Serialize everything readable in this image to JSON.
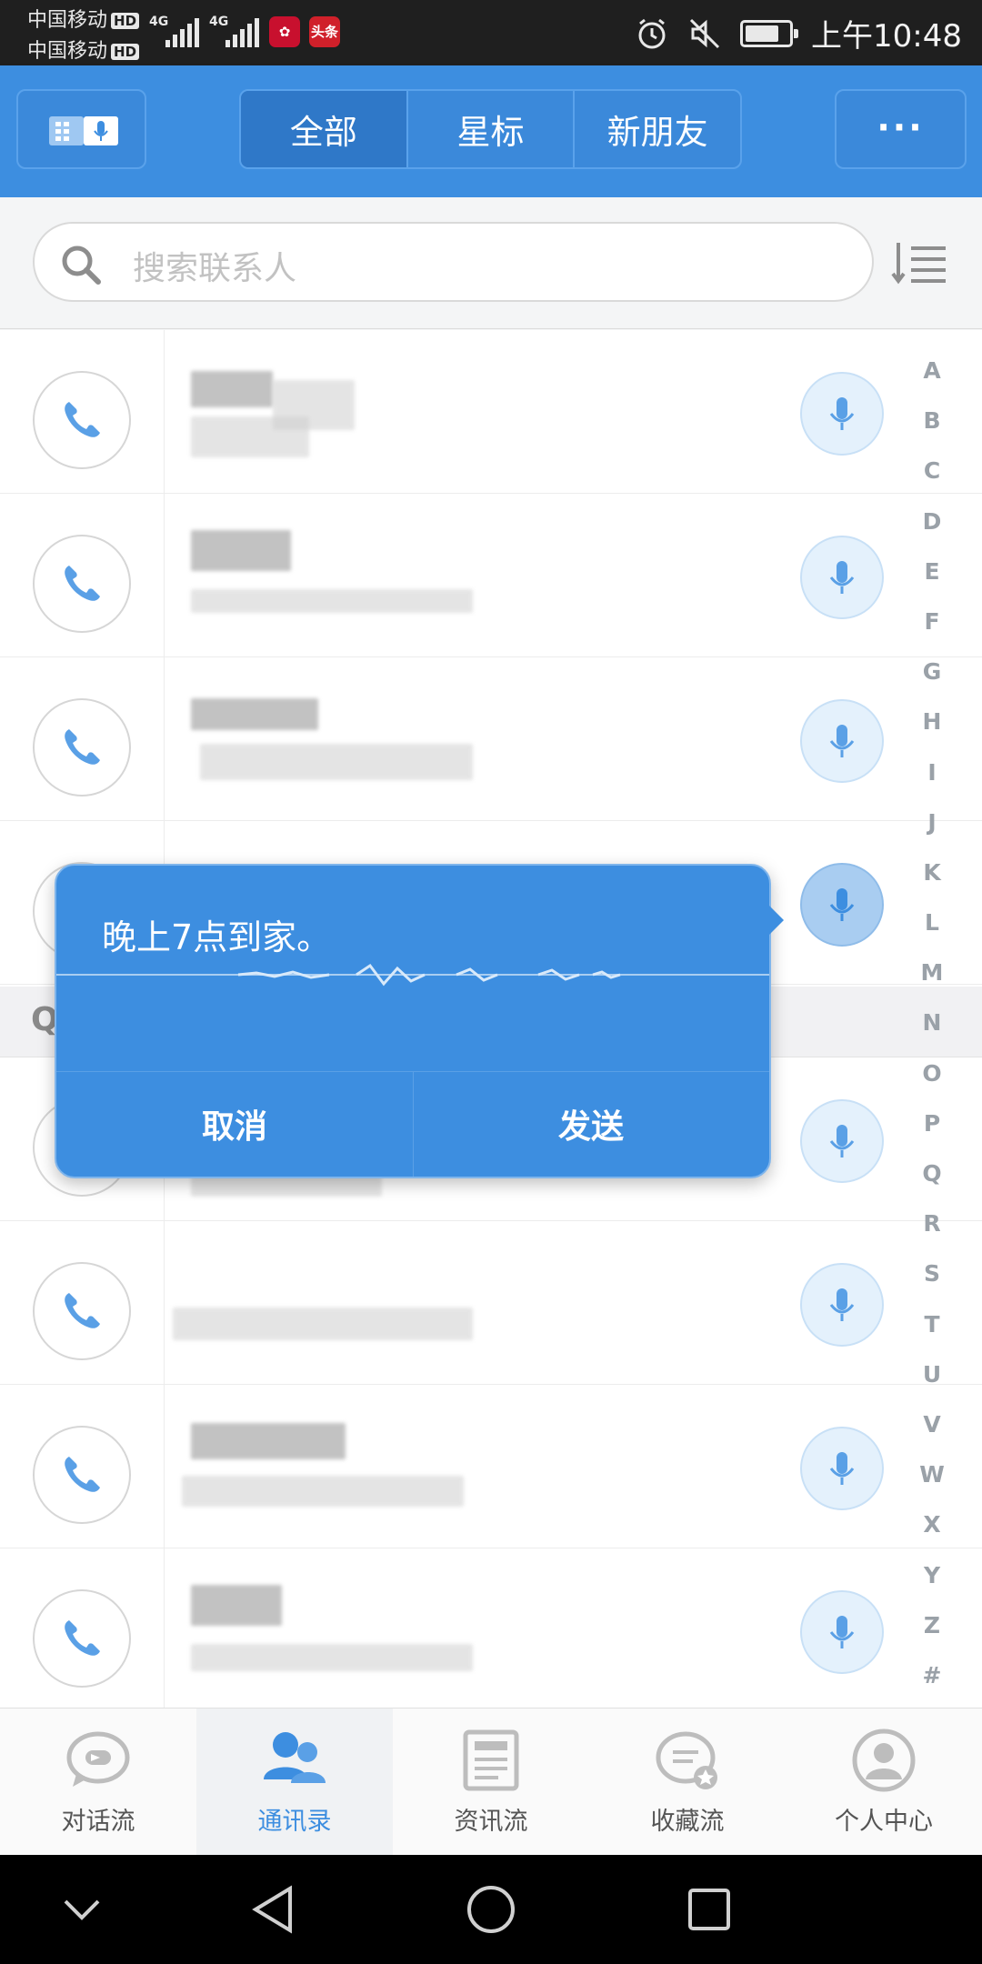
{
  "status_bar": {
    "carrier1": "中国移动",
    "carrier2": "中国移动",
    "hd": "HD",
    "net1": "4G",
    "net2": "4G",
    "app_badge": "头条",
    "time": "上午10:48"
  },
  "header": {
    "tabs": [
      {
        "label": "全部",
        "active": true
      },
      {
        "label": "星标",
        "active": false
      },
      {
        "label": "新朋友",
        "active": false
      }
    ],
    "more_label": "···"
  },
  "search": {
    "placeholder": "搜索联系人"
  },
  "section_letter": "Q",
  "alphabet": [
    "A",
    "B",
    "C",
    "D",
    "E",
    "F",
    "G",
    "H",
    "I",
    "J",
    "K",
    "L",
    "M",
    "N",
    "O",
    "P",
    "Q",
    "R",
    "S",
    "T",
    "U",
    "V",
    "W",
    "X",
    "Y",
    "Z",
    "#"
  ],
  "dialog": {
    "message": "晚上7点到家。",
    "cancel": "取消",
    "send": "发送"
  },
  "bottom_nav": [
    {
      "label": "对话流",
      "icon": "chat-bubble-icon",
      "active": false
    },
    {
      "label": "通讯录",
      "icon": "contacts-icon",
      "active": true
    },
    {
      "label": "资讯流",
      "icon": "news-icon",
      "active": false
    },
    {
      "label": "收藏流",
      "icon": "favorites-icon",
      "active": false
    },
    {
      "label": "个人中心",
      "icon": "profile-icon",
      "active": false
    }
  ],
  "colors": {
    "accent": "#3d8ee0",
    "status_bar": "#1f1f1f",
    "active_tab": "#2f78c8"
  }
}
